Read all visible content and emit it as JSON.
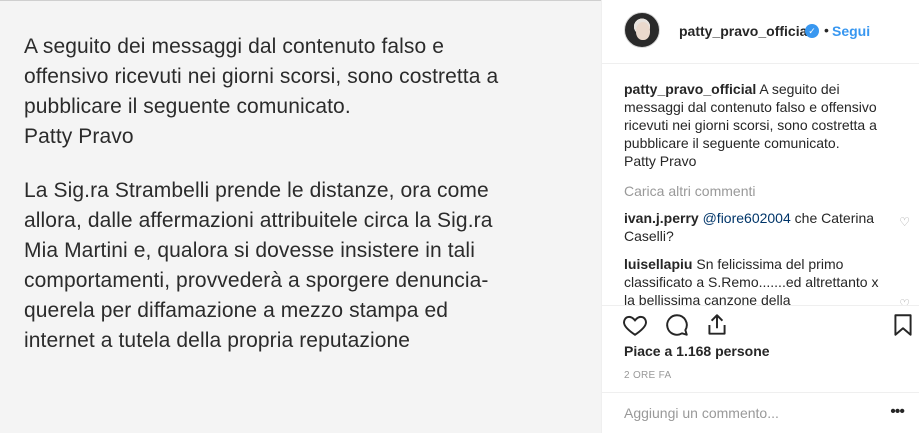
{
  "post": {
    "paragraph_1": "A seguito dei messaggi dal contenuto falso e\noffensivo ricevuti nei giorni scorsi, sono costretta a\npubblicare il seguente comunicato.\nPatty Pravo",
    "paragraph_2": "La Sig.ra Strambelli prende le distanze, ora come\nallora, dalle affermazioni attribuitele circa la Sig.ra\nMia Martini e, qualora si dovesse insistere in tali\ncomportamenti, provvederà a sporgere denuncia-\nquerela per diffamazione a mezzo stampa ed\ninternet a tutela della propria reputazione"
  },
  "header": {
    "username": "patty_pravo_official",
    "separator": "•",
    "follow_label": "Segui"
  },
  "caption": {
    "username": "patty_pravo_official",
    "text": " A seguito dei messaggi dal contenuto falso e offensivo ricevuti nei giorni scorsi, sono costretta a pubblicare il seguente comunicato.",
    "signature": "Patty Pravo"
  },
  "load_more_label": "Carica altri commenti",
  "comments": [
    {
      "username": "ivan.j.perry",
      "mention": "@fiore602004",
      "text": " che Caterina Caselli?"
    },
    {
      "username": "luisellapiu",
      "mention": "",
      "text": " Sn felicissima del primo classificato a S.Remo.......ed altrettanto x la bellissima canzone della"
    }
  ],
  "likes_label": "Piace a 1.168 persone",
  "time_label": "2 ORE FA",
  "add_comment": {
    "placeholder": "Aggiungi un commento...",
    "more_label": "•••"
  },
  "icons": [
    "verified-icon",
    "heart-icon",
    "comment-icon",
    "share-icon",
    "bookmark-icon",
    "small-heart-icon"
  ],
  "colors": {
    "link": "#3897f0",
    "muted": "#999999",
    "text": "#262626",
    "mention": "#003569"
  }
}
